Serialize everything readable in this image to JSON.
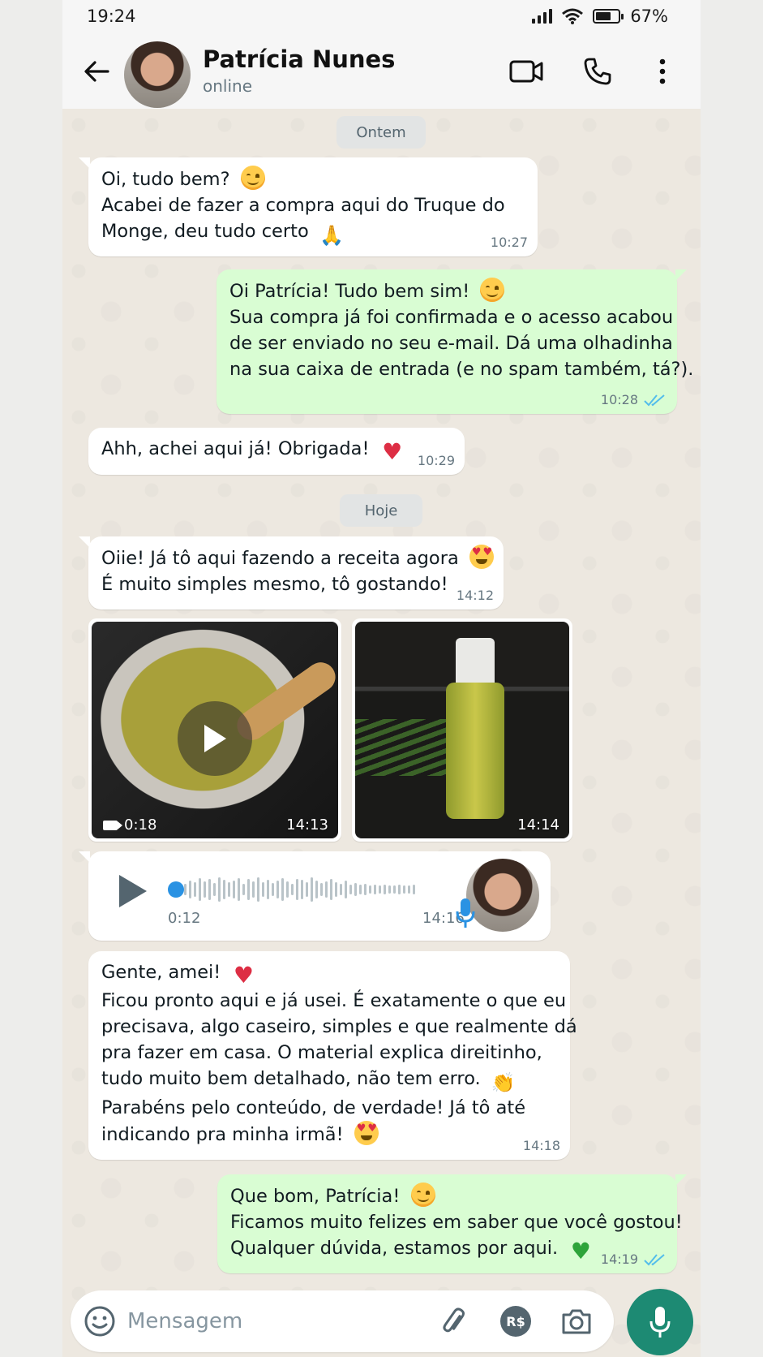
{
  "status_bar": {
    "time": "19:24",
    "battery": "67%"
  },
  "header": {
    "contact_name": "Patrícia Nunes",
    "contact_status": "online"
  },
  "date_pills": {
    "yesterday": "Ontem",
    "today": "Hoje"
  },
  "messages": [
    {
      "lines": [
        "Oi, tudo bem? ",
        "Acabei de fazer a compra aqui do Truque do",
        "Monge, deu tudo certo "
      ],
      "time": "10:27"
    },
    {
      "lines": [
        "Oi Patrícia! Tudo bem sim! ",
        "Sua compra já foi confirmada e o acesso acabou",
        "de ser enviado no seu e-mail. Dá uma olhadinha",
        "na sua caixa de entrada (e no spam também, tá?)."
      ],
      "time": "10:28"
    },
    {
      "lines": [
        "Ahh, achei aqui já! Obrigada! "
      ],
      "time": "10:29"
    },
    {
      "lines": [
        "Oiie! Já tô aqui fazendo a receita agora ",
        "É muito simples mesmo, tô gostando!"
      ],
      "time": "14:12"
    },
    {
      "lines": [
        "Gente, amei! ",
        "Ficou pronto aqui e já usei. É exatamente o que eu",
        "precisava, algo caseiro, simples e que realmente dá",
        "pra fazer em casa. O material explica direitinho,",
        "tudo muito bem detalhado, não tem erro. ",
        "Parabéns pelo conteúdo, de verdade! Já tô até",
        "indicando pra minha irmã! "
      ],
      "time": "14:18"
    },
    {
      "lines": [
        "Que bom, Patrícia! ",
        "Ficamos muito felizes em saber que você gostou!",
        "Qualquer dúvida, estamos por aqui. "
      ],
      "time": "14:19"
    }
  ],
  "media": {
    "video": {
      "duration": "0:18",
      "time": "14:13"
    },
    "photo": {
      "time": "14:14"
    }
  },
  "voice": {
    "length": "0:12",
    "time": "14:16"
  },
  "input": {
    "placeholder": "Mensagem",
    "pay_label": "R$"
  },
  "colors": {
    "outgoing_bubble": "#d9fdd3",
    "incoming_bubble": "#ffffff",
    "accent": "#1d8a73",
    "read_ticks": "#53bdeb"
  }
}
